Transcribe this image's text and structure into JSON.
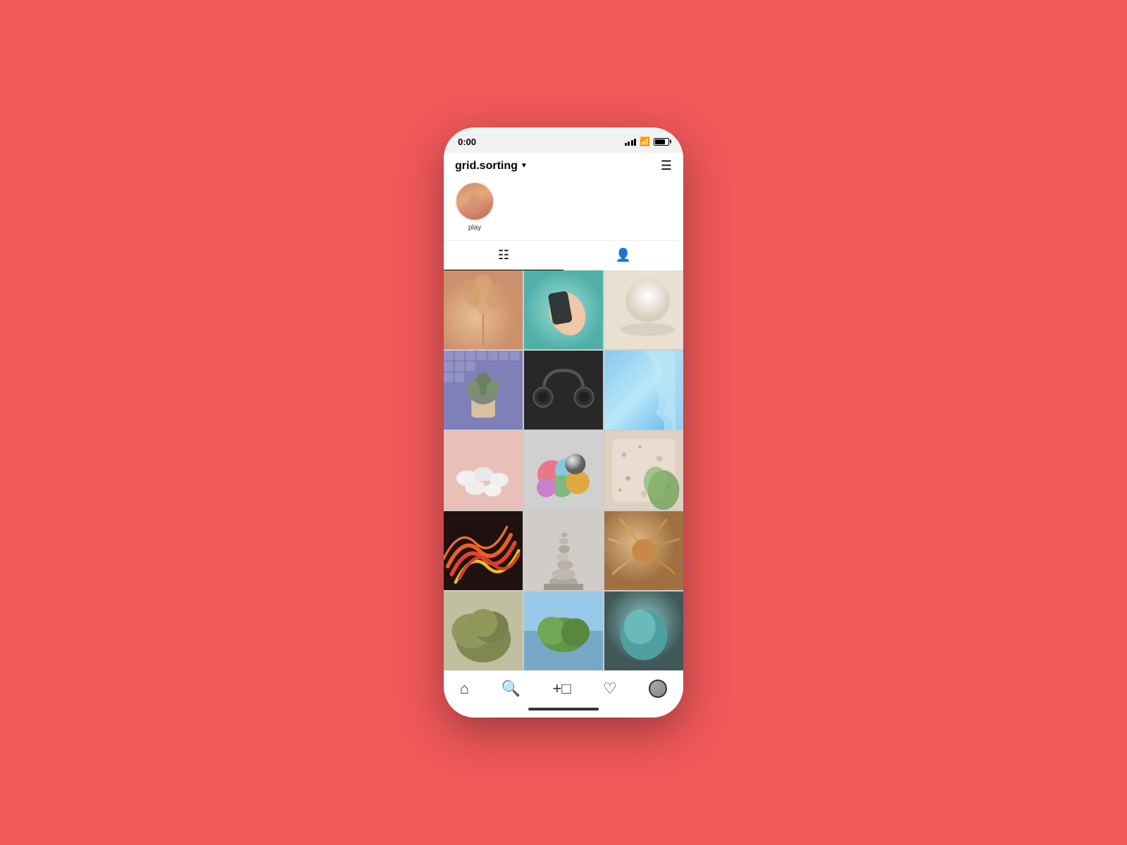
{
  "status_bar": {
    "time": "0:00",
    "signal_label": "signal",
    "wifi_label": "wifi",
    "battery_label": "battery"
  },
  "profile": {
    "username": "grid.sorting",
    "story_label": "play",
    "menu_label": "menu"
  },
  "tabs": {
    "grid_label": "grid view",
    "tag_label": "tagged view"
  },
  "nav": {
    "home_label": "home",
    "search_label": "search",
    "add_label": "add post",
    "likes_label": "likes",
    "profile_label": "profile"
  },
  "photos": [
    {
      "id": 1,
      "alt": "dried pampas flowers pink background"
    },
    {
      "id": 2,
      "alt": "hand teal background dark fabric"
    },
    {
      "id": 3,
      "alt": "white sphere on beige"
    },
    {
      "id": 4,
      "alt": "succulent in pot purple texture"
    },
    {
      "id": 5,
      "alt": "black headphones dark background"
    },
    {
      "id": 6,
      "alt": "blue fabric flowing"
    },
    {
      "id": 7,
      "alt": "white pebbles pink background"
    },
    {
      "id": 8,
      "alt": "colorful balls pink teal"
    },
    {
      "id": 9,
      "alt": "speckled ceramic texture"
    },
    {
      "id": 10,
      "alt": "red noodle tangle colorful"
    },
    {
      "id": 11,
      "alt": "stacked stones sculpture gray"
    },
    {
      "id": 12,
      "alt": "feathery texture warm brown"
    },
    {
      "id": 13,
      "alt": "green plant mossy"
    },
    {
      "id": 14,
      "alt": "blue sky mossy green"
    },
    {
      "id": 15,
      "alt": "teal object dark"
    }
  ],
  "home_indicator": {
    "label": "home indicator"
  }
}
